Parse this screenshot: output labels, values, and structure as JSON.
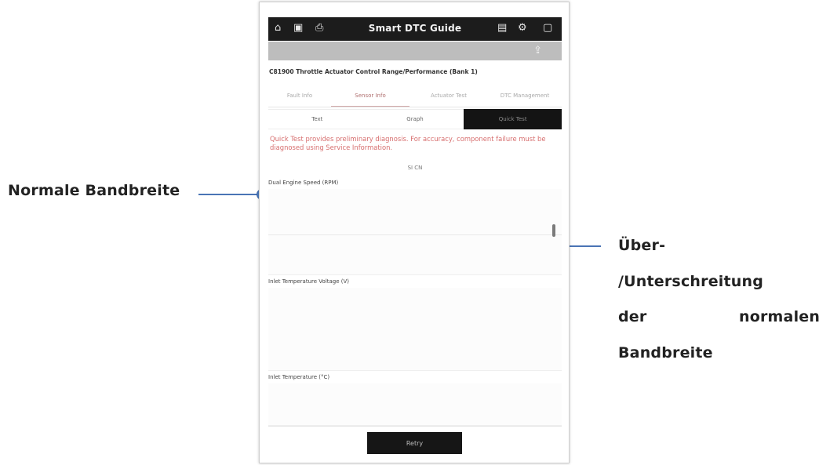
{
  "app": {
    "title": "Smart DTC Guide",
    "status_icons": [
      "home-icon",
      "car-icon",
      "lock-icon",
      "screenshot-icon",
      "settings-icon",
      "window-icon"
    ]
  },
  "dtc": {
    "title": "C81900 Throttle Actuator Control Range/Performance (Bank 1)"
  },
  "tabs": [
    {
      "label": "Fault Info"
    },
    {
      "label": "Sensor Info"
    },
    {
      "label": "Actuator Test"
    },
    {
      "label": "DTC Management"
    }
  ],
  "active_tab": "Sensor Info",
  "segments": [
    {
      "label": "Text"
    },
    {
      "label": "Graph"
    },
    {
      "label": "Quick Test"
    }
  ],
  "active_segment": "Quick Test",
  "warning_text": "Quick Test provides preliminary diagnosis. For accuracy, component failure must be diagnosed using Service Information.",
  "unit_toggle": "SI  CN",
  "parameters": [
    {
      "label": "Dual Engine Speed (RPM)"
    },
    {
      "label": "Inlet Temperature Voltage (V)"
    },
    {
      "label": "Inlet Temperature (°C)"
    }
  ],
  "retry_label": "Retry",
  "annotations": {
    "left": "Normale Bandbreite",
    "right_lines": [
      "Über-",
      "/Unterschreitung",
      "der",
      "normalen",
      "Bandbreite"
    ]
  },
  "colors": {
    "annotation_line": "#4a74b5",
    "annotation_dot": "#4f7ec4",
    "warning_text": "#d76f6f"
  }
}
